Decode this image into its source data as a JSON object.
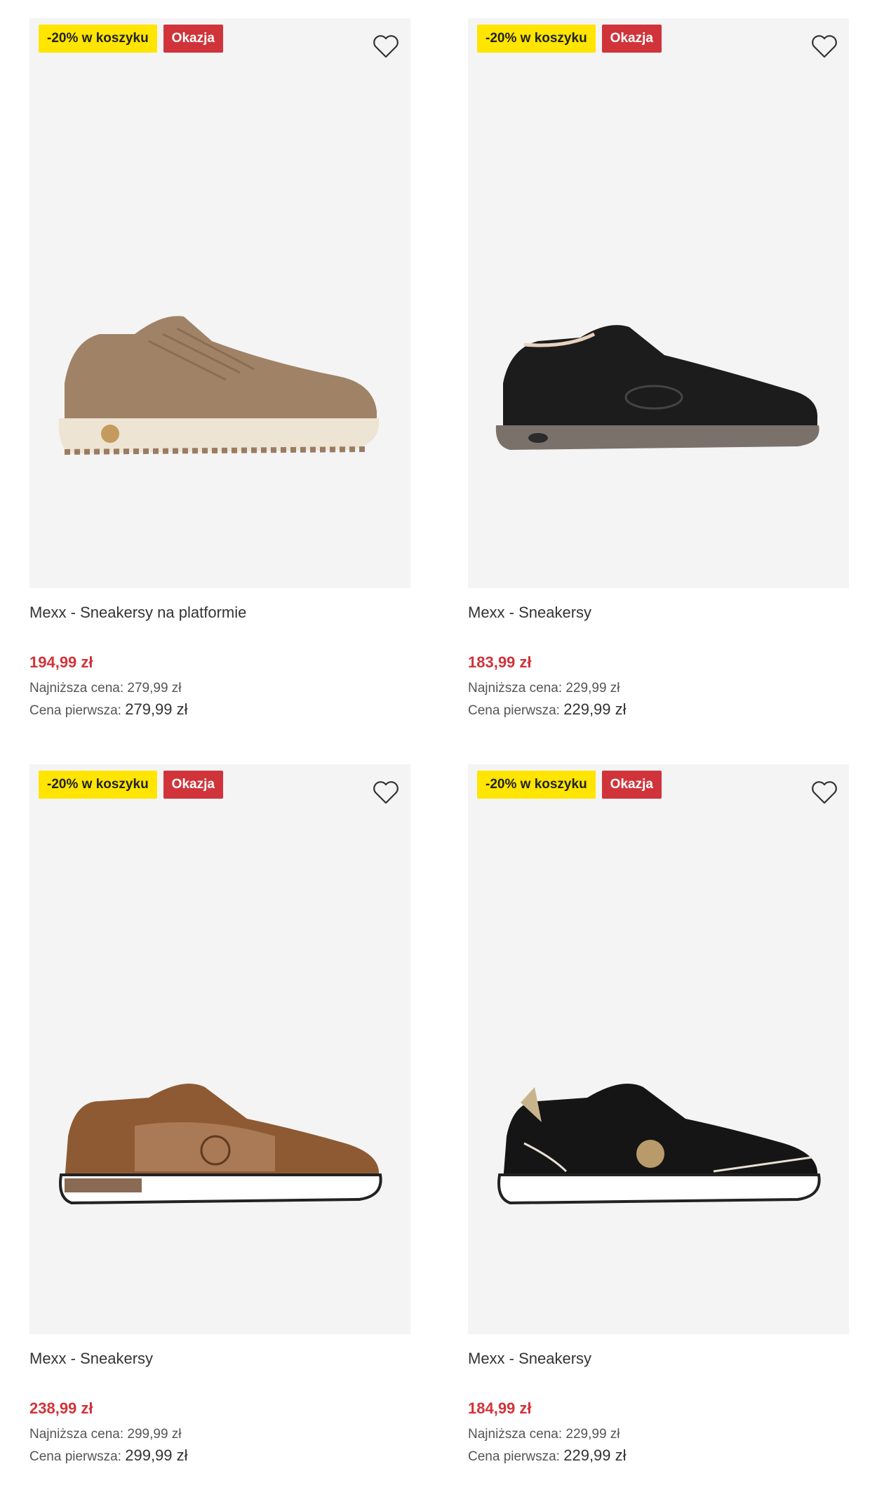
{
  "products": [
    {
      "discount_badge": "-20% w koszyku",
      "sale_badge": "Okazja",
      "name": "Mexx - Sneakersy na platformie",
      "price": "194,99 zł",
      "lowest_label": "Najniższa cena:",
      "lowest_value": "279,99 zł",
      "first_label": "Cena pierwsza:",
      "first_value": "279,99 zł",
      "shoe_color": "#a08266",
      "sole_color": "#ede4d3",
      "icon": "sneaker-image"
    },
    {
      "discount_badge": "-20% w koszyku",
      "sale_badge": "Okazja",
      "name": "Mexx - Sneakersy",
      "price": "183,99 zł",
      "lowest_label": "Najniższa cena:",
      "lowest_value": "229,99 zł",
      "first_label": "Cena pierwsza:",
      "first_value": "229,99 zł",
      "shoe_color": "#1c1c1c",
      "sole_color": "#7a716b",
      "icon": "sneaker-image"
    },
    {
      "discount_badge": "-20% w koszyku",
      "sale_badge": "Okazja",
      "name": "Mexx - Sneakersy",
      "price": "238,99 zł",
      "lowest_label": "Najniższa cena:",
      "lowest_value": "299,99 zł",
      "first_label": "Cena pierwsza:",
      "first_value": "299,99 zł",
      "shoe_color": "#8e5a33",
      "sole_color": "#ffffff",
      "icon": "sneaker-image"
    },
    {
      "discount_badge": "-20% w koszyku",
      "sale_badge": "Okazja",
      "name": "Mexx - Sneakersy",
      "price": "184,99 zł",
      "lowest_label": "Najniższa cena:",
      "lowest_value": "229,99 zł",
      "first_label": "Cena pierwsza:",
      "first_value": "229,99 zł",
      "shoe_color": "#151515",
      "sole_color": "#ffffff",
      "icon": "sneaker-image"
    }
  ],
  "colors": {
    "discount": "#ffe500",
    "sale": "#d0343a",
    "price": "#d0343a",
    "image_bg": "#f4f4f4"
  }
}
